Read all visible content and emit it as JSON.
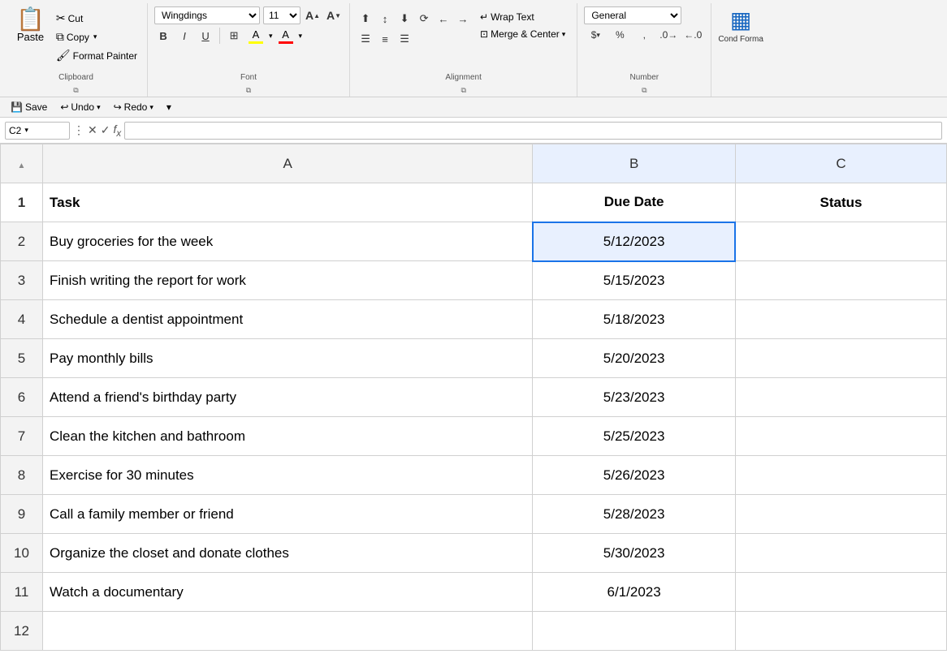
{
  "ribbon": {
    "clipboard": {
      "label": "Clipboard",
      "paste": "Paste",
      "cut": "Cut",
      "copy": "Copy",
      "format_painter": "Format Painter"
    },
    "font": {
      "label": "Font",
      "font_name": "Wingdings",
      "font_size": "11",
      "bold": "B",
      "italic": "I",
      "underline": "U",
      "borders": "⊞",
      "fill_color": "A",
      "font_color": "A"
    },
    "alignment": {
      "label": "Alignment",
      "wrap_text": "Wrap Text",
      "merge_center": "Merge & Center"
    },
    "number": {
      "label": "Number",
      "format": "General",
      "dollar": "$",
      "percent": "%",
      "comma": ","
    },
    "cond_format": {
      "label": "Cond Forma"
    }
  },
  "formula_bar": {
    "cell_ref": "C2",
    "formula": ""
  },
  "quick_access": {
    "save": "Save",
    "undo": "Undo",
    "redo": "Redo"
  },
  "sheet": {
    "columns": [
      "A",
      "B",
      "C"
    ],
    "headers": {
      "task": "Task",
      "due_date": "Due Date",
      "status": "Status"
    },
    "rows": [
      {
        "num": 2,
        "task": "Buy groceries for the week",
        "due_date": "5/12/2023",
        "status": ""
      },
      {
        "num": 3,
        "task": "Finish writing the report for work",
        "due_date": "5/15/2023",
        "status": ""
      },
      {
        "num": 4,
        "task": "Schedule a dentist appointment",
        "due_date": "5/18/2023",
        "status": ""
      },
      {
        "num": 5,
        "task": "Pay monthly bills",
        "due_date": "5/20/2023",
        "status": ""
      },
      {
        "num": 6,
        "task": "Attend a friend's birthday party",
        "due_date": "5/23/2023",
        "status": ""
      },
      {
        "num": 7,
        "task": "Clean the kitchen and bathroom",
        "due_date": "5/25/2023",
        "status": ""
      },
      {
        "num": 8,
        "task": "Exercise for 30 minutes",
        "due_date": "5/26/2023",
        "status": ""
      },
      {
        "num": 9,
        "task": "Call a family member or friend",
        "due_date": "5/28/2023",
        "status": ""
      },
      {
        "num": 10,
        "task": "Organize the closet and donate clothes",
        "due_date": "5/30/2023",
        "status": ""
      },
      {
        "num": 11,
        "task": "Watch a documentary",
        "due_date": "6/1/2023",
        "status": ""
      },
      {
        "num": 12,
        "task": "",
        "due_date": "",
        "status": ""
      }
    ]
  }
}
